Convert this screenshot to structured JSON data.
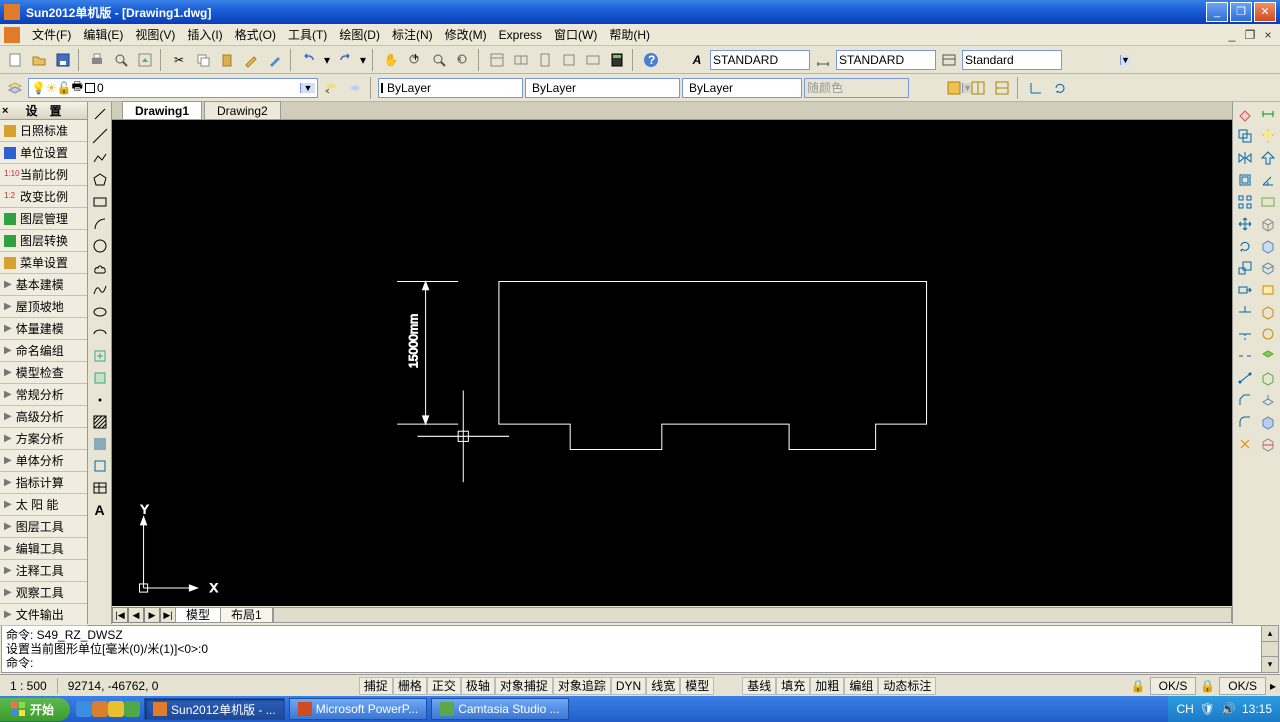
{
  "window": {
    "title": "Sun2012单机版 - [Drawing1.dwg]"
  },
  "menus": [
    "文件(F)",
    "编辑(E)",
    "视图(V)",
    "插入(I)",
    "格式(O)",
    "工具(T)",
    "绘图(D)",
    "标注(N)",
    "修改(M)",
    "Express",
    "窗口(W)",
    "帮助(H)"
  ],
  "toolbar_row1": {
    "text_style": "STANDARD",
    "dim_style": "STANDARD",
    "table_style": "Standard"
  },
  "toolbar_row2": {
    "layer": "0",
    "linetype": "ByLayer",
    "lineweight": "ByLayer",
    "plotstyle": "ByLayer",
    "color_label": "随颜色"
  },
  "sidepanel": {
    "title": "设　置",
    "items": [
      {
        "label": "日照标准",
        "icon": "#d8a030"
      },
      {
        "label": "单位设置",
        "icon": "#3060d0"
      },
      {
        "label": "当前比例",
        "icon": "#c03030",
        "prefix": "1:10"
      },
      {
        "label": "改变比例",
        "icon": "#c03030",
        "prefix": "1:2"
      },
      {
        "label": "图层管理",
        "icon": "#30a040"
      },
      {
        "label": "图层转换",
        "icon": "#30a040"
      },
      {
        "label": "菜单设置",
        "icon": "#d8a030"
      },
      {
        "label": "基本建模",
        "arrow": true
      },
      {
        "label": "屋顶坡地",
        "arrow": true
      },
      {
        "label": "体量建模",
        "arrow": true
      },
      {
        "label": "命名编组",
        "arrow": true
      },
      {
        "label": "模型检查",
        "arrow": true
      },
      {
        "label": "常规分析",
        "arrow": true
      },
      {
        "label": "高级分析",
        "arrow": true
      },
      {
        "label": "方案分析",
        "arrow": true
      },
      {
        "label": "单体分析",
        "arrow": true
      },
      {
        "label": "指标计算",
        "arrow": true
      },
      {
        "label": "太 阳 能",
        "arrow": true
      },
      {
        "label": "图层工具",
        "arrow": true
      },
      {
        "label": "编辑工具",
        "arrow": true
      },
      {
        "label": "注释工具",
        "arrow": true
      },
      {
        "label": "观察工具",
        "arrow": true
      },
      {
        "label": "文件输出",
        "arrow": true
      }
    ]
  },
  "tabs": {
    "doc1": "Drawing1",
    "doc2": "Drawing2"
  },
  "bottom_tabs": {
    "model": "模型",
    "layout1": "布局1"
  },
  "canvas": {
    "dim_text": "15000mm",
    "ucs_x": "X",
    "ucs_y": "Y"
  },
  "command": {
    "line1": "命令: S49_RZ_DWSZ",
    "line2": "设置当前图形单位[毫米(0)/米(1)]<0>:0",
    "prompt": "命令:"
  },
  "status": {
    "scale": "1 : 500",
    "coords": "92714, -46762, 0",
    "toggles": [
      "捕捉",
      "栅格",
      "正交",
      "极轴",
      "对象捕捉",
      "对象追踪",
      "DYN",
      "线宽",
      "模型"
    ],
    "toggles2": [
      "基线",
      "填充",
      "加粗",
      "编组",
      "动态标注"
    ],
    "ok1": "OK/S",
    "ok2": "OK/S"
  },
  "taskbar": {
    "start": "开始",
    "apps": [
      {
        "label": "Sun2012单机版 - ...",
        "active": true,
        "color": "#e07b2a"
      },
      {
        "label": "Microsoft PowerP...",
        "active": false,
        "color": "#d24b20"
      },
      {
        "label": "Camtasia Studio ...",
        "active": false,
        "color": "#5aa84a"
      }
    ],
    "tray": {
      "ime": "CH",
      "time": "13:15"
    }
  },
  "chart_data": {
    "type": "diagram",
    "note": "CAD polyline with vertical 15000mm dimension; building-footprint outline with two recessed notches on bottom edge",
    "dimension": {
      "value": 15000,
      "unit": "mm",
      "orientation": "vertical"
    }
  }
}
